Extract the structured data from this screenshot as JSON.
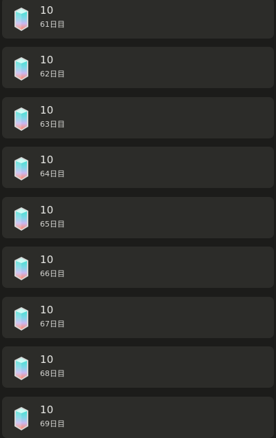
{
  "rewards": [
    {
      "amount": "10",
      "day": "61日目",
      "icon": "crystal-gem-icon"
    },
    {
      "amount": "10",
      "day": "62日目",
      "icon": "crystal-gem-icon"
    },
    {
      "amount": "10",
      "day": "63日目",
      "icon": "crystal-gem-icon"
    },
    {
      "amount": "10",
      "day": "64日目",
      "icon": "crystal-gem-icon"
    },
    {
      "amount": "10",
      "day": "65日目",
      "icon": "crystal-gem-icon"
    },
    {
      "amount": "10",
      "day": "66日目",
      "icon": "crystal-gem-icon"
    },
    {
      "amount": "10",
      "day": "67日目",
      "icon": "crystal-gem-icon"
    },
    {
      "amount": "10",
      "day": "68日目",
      "icon": "crystal-gem-icon"
    },
    {
      "amount": "10",
      "day": "69日目",
      "icon": "crystal-gem-icon"
    }
  ],
  "colors": {
    "background": "#1c1c1a",
    "card": "#2c2c29",
    "text_primary": "#e6e6e3",
    "text_secondary": "#d2d2cf"
  }
}
